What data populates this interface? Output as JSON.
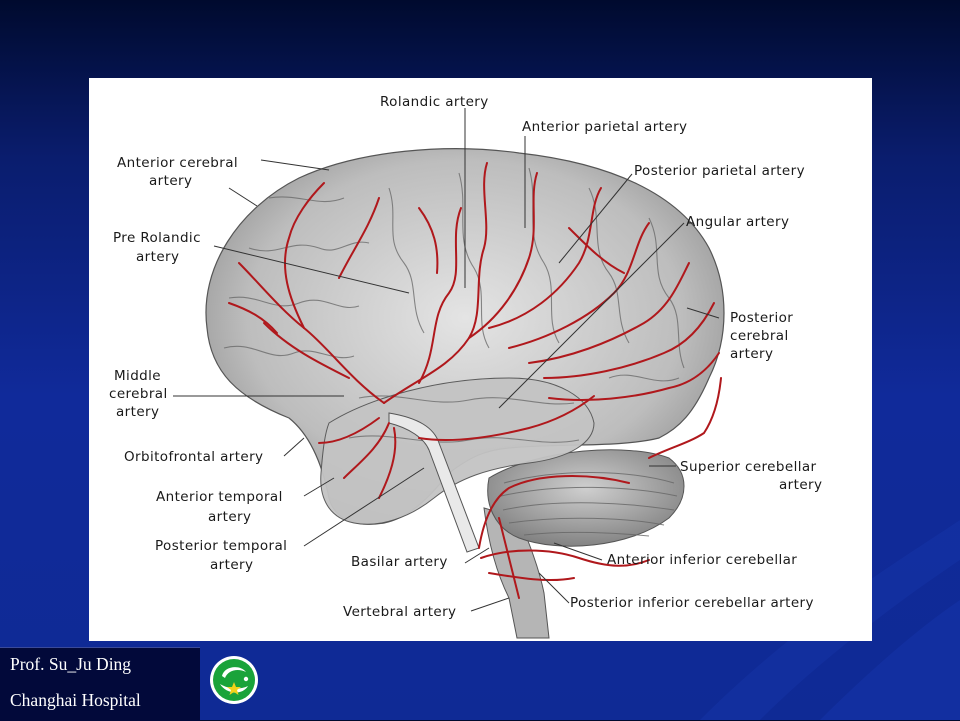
{
  "figure": {
    "labels": {
      "rolandic": "Rolandic artery",
      "anterior_parietal": "Anterior parietal artery",
      "anterior_cerebral_1": "Anterior cerebral",
      "anterior_cerebral_2": "artery",
      "posterior_parietal": "Posterior parietal artery",
      "angular": "Angular artery",
      "pre_rolandic_1": "Pre Rolandic",
      "pre_rolandic_2": "artery",
      "posterior_cerebral_1": "Posterior",
      "posterior_cerebral_2": "cerebral",
      "posterior_cerebral_3": "artery",
      "middle_cerebral_1": "Middle",
      "middle_cerebral_2": "cerebral",
      "middle_cerebral_3": "artery",
      "orbitofrontal": "Orbitofrontal artery",
      "superior_cerebellar_1": "Superior cerebellar",
      "superior_cerebellar_2": "artery",
      "anterior_temporal_1": "Anterior temporal",
      "anterior_temporal_2": "artery",
      "posterior_temporal_1": "Posterior temporal",
      "posterior_temporal_2": "artery",
      "basilar": "Basilar artery",
      "anterior_inferior_cerebellar": "Anterior inferior cerebellar",
      "vertebral": "Vertebral artery",
      "posterior_inferior_cerebellar": "Posterior inferior cerebellar artery"
    }
  },
  "footer": {
    "author": "Prof. Su_Ju Ding",
    "institution": "Changhai Hospital"
  },
  "colors": {
    "artery": "#b0181c",
    "brain_base": "#c9c9c9",
    "slide_bg": "#102a9a"
  }
}
